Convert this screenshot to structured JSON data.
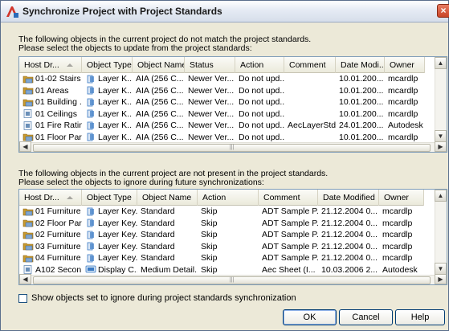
{
  "window": {
    "title": "Synchronize Project with Project Standards",
    "close_label": "×"
  },
  "top": {
    "instruction_line1": "The following objects in the current project do not match the project standards.",
    "instruction_line2": "Please select the objects to update from the project standards:",
    "columns": [
      "Host Dr...",
      "Object Type",
      "Object Name",
      "Status",
      "Action",
      "Comment",
      "Date Modi...",
      "Owner"
    ],
    "rows": [
      {
        "icon": "folder-drawing-icon",
        "host": "01-02 Stairs",
        "type": "Layer K...",
        "name": "AIA (256 C...",
        "status": "Newer Ver...",
        "action": "Do not upd...",
        "comment": "",
        "date": "10.01.200...",
        "owner": "mcardlp"
      },
      {
        "icon": "folder-drawing-icon",
        "host": "01 Areas",
        "type": "Layer K...",
        "name": "AIA (256 C...",
        "status": "Newer Ver...",
        "action": "Do not upd...",
        "comment": "",
        "date": "10.01.200...",
        "owner": "mcardlp"
      },
      {
        "icon": "folder-drawing-icon",
        "host": "01 Building ...",
        "type": "Layer K...",
        "name": "AIA (256 C...",
        "status": "Newer Ver...",
        "action": "Do not upd...",
        "comment": "",
        "date": "10.01.200...",
        "owner": "mcardlp"
      },
      {
        "icon": "sheet-drawing-icon",
        "host": "01 Ceilings",
        "type": "Layer K...",
        "name": "AIA (256 C...",
        "status": "Newer Ver...",
        "action": "Do not upd...",
        "comment": "",
        "date": "10.01.200...",
        "owner": "mcardlp"
      },
      {
        "icon": "sheet-drawing-icon",
        "host": "01 Fire Ratin...",
        "type": "Layer K...",
        "name": "AIA (256 C...",
        "status": "Newer Ver...",
        "action": "Do not upd...",
        "comment": "AecLayerStd",
        "date": "24.01.200...",
        "owner": "Autodesk"
      },
      {
        "icon": "folder-drawing-icon",
        "host": "01 Floor Par...",
        "type": "Layer K...",
        "name": "AIA (256 C...",
        "status": "Newer Ver...",
        "action": "Do not upd...",
        "comment": "",
        "date": "10.01.200...",
        "owner": "mcardlp"
      }
    ]
  },
  "bottom": {
    "instruction_line1": "The following objects in the current project are not present in the project standards.",
    "instruction_line2": "Please select the objects to ignore during future synchronizations:",
    "columns": [
      "Host Dr...",
      "Object Type",
      "Object Name",
      "Action",
      "Comment",
      "Date Modified",
      "Owner"
    ],
    "rows": [
      {
        "icon": "folder-drawing-icon",
        "type_icon": "layer-key-icon",
        "host": "01 Furniture",
        "type": "Layer Key...",
        "name": "Standard",
        "action": "Skip",
        "comment": "ADT Sample P...",
        "date": "21.12.2004 0...",
        "owner": "mcardlp"
      },
      {
        "icon": "folder-drawing-icon",
        "type_icon": "layer-key-icon",
        "host": "02 Floor Par...",
        "type": "Layer Key...",
        "name": "Standard",
        "action": "Skip",
        "comment": "ADT Sample P...",
        "date": "21.12.2004 0...",
        "owner": "mcardlp"
      },
      {
        "icon": "folder-drawing-icon",
        "type_icon": "layer-key-icon",
        "host": "02 Furniture",
        "type": "Layer Key...",
        "name": "Standard",
        "action": "Skip",
        "comment": "ADT Sample P...",
        "date": "21.12.2004 0...",
        "owner": "mcardlp"
      },
      {
        "icon": "folder-drawing-icon",
        "type_icon": "layer-key-icon",
        "host": "03 Furniture",
        "type": "Layer Key...",
        "name": "Standard",
        "action": "Skip",
        "comment": "ADT Sample P...",
        "date": "21.12.2004 0...",
        "owner": "mcardlp"
      },
      {
        "icon": "folder-drawing-icon",
        "type_icon": "layer-key-icon",
        "host": "04 Furniture",
        "type": "Layer Key...",
        "name": "Standard",
        "action": "Skip",
        "comment": "ADT Sample P...",
        "date": "21.12.2004 0...",
        "owner": "mcardlp"
      },
      {
        "icon": "sheet-drawing-icon",
        "type_icon": "display-config-icon",
        "host": "A102 Secon...",
        "type": "Display C...",
        "name": "Medium Detail...",
        "action": "Skip",
        "comment": "Aec Sheet (I...",
        "date": "10.03.2006 2...",
        "owner": "Autodesk"
      }
    ]
  },
  "checkbox_label": "Show objects set to ignore during project standards synchronization",
  "buttons": {
    "ok": "OK",
    "cancel": "Cancel",
    "help": "Help"
  },
  "colors": {
    "folder": "#c99a2e",
    "sheet": "#6a8fb8",
    "layer": "#3a7ac4"
  }
}
